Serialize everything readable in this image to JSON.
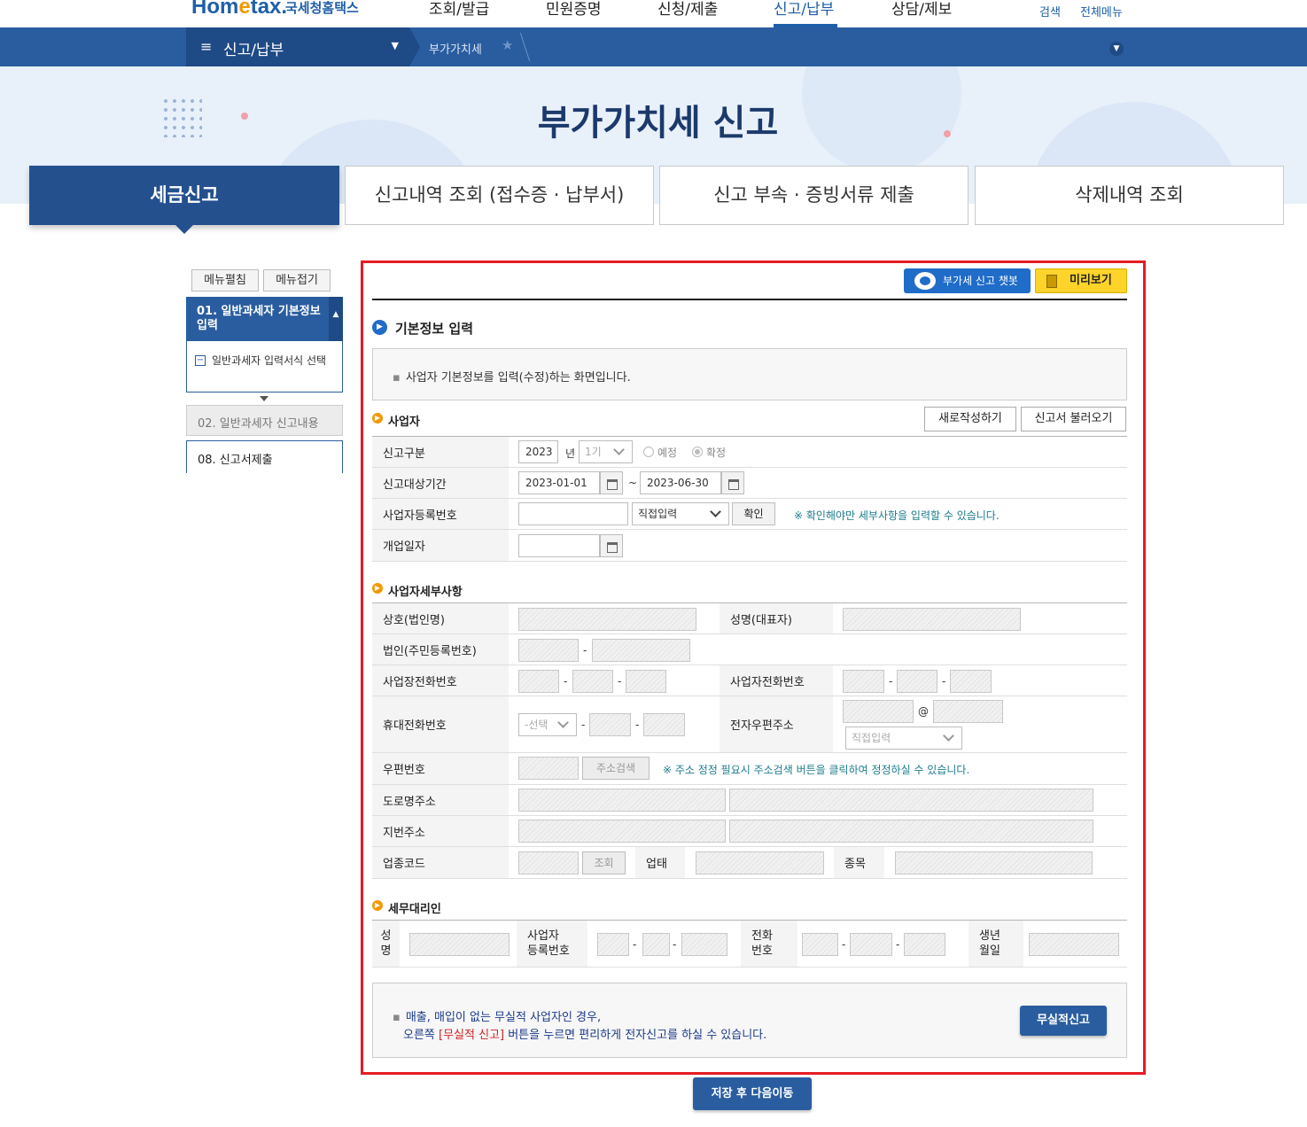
{
  "gnb": {
    "logo_main": "Hom",
    "logo_e": "e",
    "logo_tax": "tax.",
    "logo_sub": "국세청홈택스",
    "items": [
      "조회/발급",
      "민원증명",
      "신청/제출",
      "신고/납부",
      "상담/제보"
    ],
    "search": "검색",
    "allmenu": "전체메뉴"
  },
  "crumb": {
    "menu": "신고/납부",
    "current": "부가가치세"
  },
  "hero": {
    "title": "부가가치세 신고"
  },
  "tabs": [
    "세금신고",
    "신고내역 조회 (접수증 · 납부서)",
    "신고 부속 · 증빙서류 제출",
    "삭제내역 조회"
  ],
  "leftmenu": {
    "expand": "메뉴펼침",
    "collapse": "메뉴접기",
    "step1": "01. 일반과세자 기본정보 입력",
    "step1_sub": "일반과세자 입력서식 선택",
    "step2": "02. 일반과세자 신고내용",
    "step3": "08. 신고서제출"
  },
  "actions": {
    "chatbot": "부가세 신고 챗봇",
    "preview": "미리보기"
  },
  "section": {
    "title": "기본정보 입력",
    "info": "사업자 기본정보를 입력(수정)하는 화면입니다."
  },
  "business": {
    "title": "사업자",
    "new_btn": "새로작성하기",
    "load_btn": "신고서 불러오기",
    "rows": {
      "type_label": "신고구분",
      "year": "2023",
      "year_unit": "년",
      "period": "1기",
      "opt_prelim": "예정",
      "opt_final": "확정",
      "period_label": "신고대상기간",
      "date_from": "2023-01-01",
      "tilde": "~",
      "date_to": "2023-06-30",
      "bizno_label": "사업자등록번호",
      "bizno_mode": "직접입력",
      "confirm_btn": "확인",
      "bizno_note": "※ 확인해야만 세부사항을 입력할 수 있습니다.",
      "open_label": "개업일자"
    }
  },
  "detail": {
    "title": "사업자세부사항",
    "name_label": "상호(법인명)",
    "rep_label": "성명(대표자)",
    "corp_label": "법인(주민등록번호)",
    "site_tel_label": "사업장전화번호",
    "biz_tel_label": "사업자전화번호",
    "mobile_label": "휴대전화번호",
    "mobile_sel": "-선택",
    "email_label": "전자우편주소",
    "email_at": "@",
    "email_mode": "직접입력",
    "zip_label": "우편번호",
    "zip_btn": "주소검색",
    "zip_note": "※ 주소 정정 필요시 주소검색 버튼을 클릭하여 정정하실 수 있습니다.",
    "road_label": "도로명주소",
    "lot_label": "지번주소",
    "industry_label": "업종코드",
    "industry_btn": "조회",
    "biztype_label": "업태",
    "item_label": "종목",
    "dash": "-"
  },
  "agent": {
    "title": "세무대리인",
    "name_l1": "성",
    "name_l2": "명",
    "bizno_l1": "사업자",
    "bizno_l2": "등록번호",
    "tel_l1": "전화",
    "tel_l2": "번호",
    "birth_l1": "생년",
    "birth_l2": "월일"
  },
  "bottom": {
    "line1": "매출, 매입이 없는 무실적 사업자인 경우,",
    "line2_pre": "오른쪽 ",
    "line2_red": "[무실적 신고]",
    "line2_post": " 버튼을 누르면 편리하게 전자신고를 하실 수 있습니다.",
    "noperf_btn": "무실적신고",
    "save_btn": "저장 후 다음이동"
  },
  "colors": {
    "brand_blue": "#2a5d9f",
    "highlight_red": "#e51c24",
    "accent_orange": "#f39800"
  }
}
